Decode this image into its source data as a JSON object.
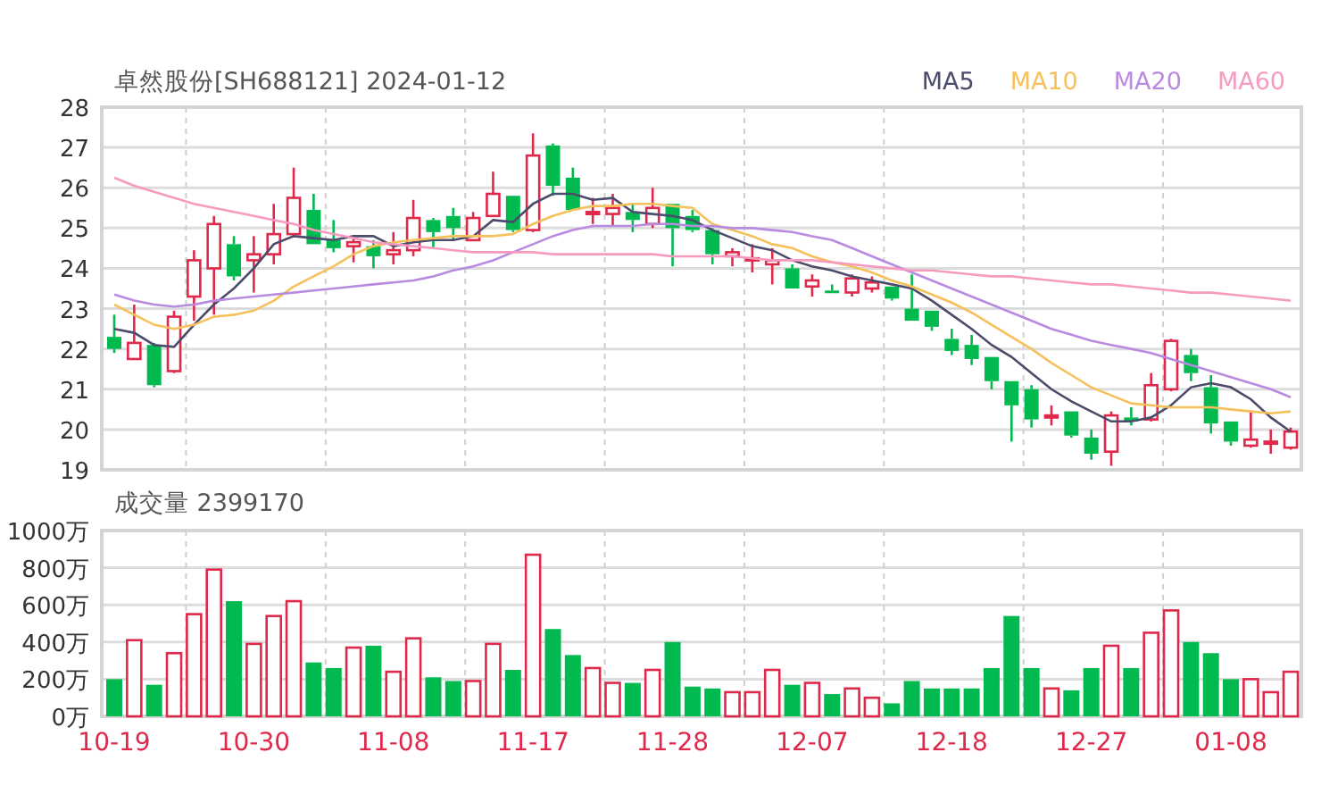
{
  "header": {
    "title": "卓然股份[SH688121] 2024-01-12"
  },
  "price_chart": {
    "chart_data": {
      "type": "candlestick",
      "grid": true,
      "ylim": [
        19,
        28
      ],
      "yticks": [
        19,
        20,
        21,
        22,
        23,
        24,
        25,
        26,
        27,
        28
      ],
      "ohlc": [
        [
          22.3,
          22.85,
          21.9,
          22.0
        ],
        [
          21.75,
          23.1,
          21.75,
          22.15
        ],
        [
          22.1,
          22.15,
          21.05,
          21.1
        ],
        [
          21.45,
          22.95,
          21.4,
          22.8
        ],
        [
          23.3,
          24.45,
          22.7,
          24.2
        ],
        [
          24.0,
          25.3,
          22.85,
          25.1
        ],
        [
          24.6,
          24.8,
          23.7,
          23.8
        ],
        [
          24.2,
          24.8,
          23.4,
          24.35
        ],
        [
          24.35,
          25.6,
          24.1,
          24.85
        ],
        [
          24.85,
          26.5,
          24.8,
          25.75
        ],
        [
          25.45,
          25.85,
          24.6,
          24.6
        ],
        [
          24.7,
          25.2,
          24.4,
          24.5
        ],
        [
          24.55,
          24.8,
          24.15,
          24.65
        ],
        [
          24.55,
          24.7,
          24.0,
          24.3
        ],
        [
          24.35,
          24.9,
          24.1,
          24.45
        ],
        [
          24.45,
          25.7,
          24.3,
          25.25
        ],
        [
          25.2,
          25.25,
          24.5,
          24.9
        ],
        [
          25.3,
          25.5,
          24.7,
          25.0
        ],
        [
          24.7,
          25.4,
          24.7,
          25.25
        ],
        [
          25.3,
          26.4,
          25.3,
          25.85
        ],
        [
          25.8,
          25.8,
          24.9,
          24.95
        ],
        [
          24.95,
          27.35,
          24.9,
          26.8
        ],
        [
          27.05,
          27.1,
          25.8,
          26.05
        ],
        [
          26.25,
          26.5,
          25.45,
          25.45
        ],
        [
          25.35,
          25.75,
          25.1,
          25.4
        ],
        [
          25.35,
          25.85,
          25.05,
          25.5
        ],
        [
          25.4,
          25.6,
          24.9,
          25.2
        ],
        [
          25.1,
          26.0,
          25.0,
          25.5
        ],
        [
          25.6,
          25.6,
          24.05,
          25.0
        ],
        [
          25.3,
          25.45,
          24.9,
          24.95
        ],
        [
          24.95,
          25.0,
          24.1,
          24.35
        ],
        [
          24.3,
          24.5,
          24.05,
          24.4
        ],
        [
          24.25,
          24.6,
          23.9,
          24.25
        ],
        [
          24.1,
          24.5,
          23.6,
          24.2
        ],
        [
          24.0,
          24.1,
          23.5,
          23.5
        ],
        [
          23.55,
          23.85,
          23.3,
          23.7
        ],
        [
          23.45,
          23.6,
          23.4,
          23.4
        ],
        [
          23.4,
          23.85,
          23.3,
          23.75
        ],
        [
          23.5,
          23.8,
          23.4,
          23.65
        ],
        [
          23.55,
          23.55,
          23.2,
          23.25
        ],
        [
          23.0,
          23.85,
          22.7,
          22.7
        ],
        [
          22.95,
          22.95,
          22.45,
          22.55
        ],
        [
          22.25,
          22.5,
          21.85,
          21.95
        ],
        [
          22.1,
          22.35,
          21.6,
          21.75
        ],
        [
          21.8,
          21.8,
          21.0,
          21.2
        ],
        [
          21.2,
          21.2,
          19.7,
          20.6
        ],
        [
          21.0,
          21.1,
          20.05,
          20.25
        ],
        [
          20.3,
          20.6,
          20.1,
          20.35
        ],
        [
          20.45,
          20.45,
          19.8,
          19.85
        ],
        [
          19.8,
          20.0,
          19.25,
          19.4
        ],
        [
          19.45,
          20.45,
          19.1,
          20.35
        ],
        [
          20.3,
          20.55,
          20.1,
          20.2
        ],
        [
          20.25,
          21.4,
          20.2,
          21.1
        ],
        [
          21.0,
          22.25,
          20.95,
          22.2
        ],
        [
          21.85,
          22.0,
          21.2,
          21.4
        ],
        [
          21.05,
          21.35,
          19.9,
          20.15
        ],
        [
          20.2,
          20.2,
          19.6,
          19.7
        ],
        [
          19.6,
          20.45,
          19.55,
          19.75
        ],
        [
          19.65,
          20.0,
          19.4,
          19.7
        ],
        [
          19.55,
          20.05,
          19.5,
          19.95
        ]
      ]
    }
  },
  "moving_averages": {
    "chart_data": {
      "type": "line",
      "ylim": [
        19,
        28
      ],
      "series": [
        {
          "name": "MA5",
          "color": "#4b4b6b",
          "values": [
            22.5,
            22.4,
            22.1,
            22.05,
            22.6,
            23.1,
            23.5,
            24.0,
            24.6,
            24.8,
            24.75,
            24.7,
            24.8,
            24.8,
            24.55,
            24.65,
            24.7,
            24.7,
            24.8,
            25.2,
            25.15,
            25.6,
            25.85,
            25.85,
            25.7,
            25.75,
            25.4,
            25.35,
            25.3,
            25.2,
            24.95,
            24.75,
            24.55,
            24.45,
            24.2,
            24.05,
            23.95,
            23.8,
            23.7,
            23.6,
            23.5,
            23.2,
            22.85,
            22.5,
            22.1,
            21.8,
            21.4,
            21.0,
            20.7,
            20.45,
            20.2,
            20.2,
            20.3,
            20.6,
            21.05,
            21.15,
            21.05,
            20.75,
            20.3,
            19.95
          ]
        },
        {
          "name": "MA10",
          "color": "#f6c05b",
          "values": [
            23.1,
            22.85,
            22.6,
            22.5,
            22.6,
            22.8,
            22.85,
            22.95,
            23.2,
            23.55,
            23.8,
            24.05,
            24.35,
            24.55,
            24.65,
            24.7,
            24.75,
            24.8,
            24.8,
            24.8,
            24.85,
            25.1,
            25.3,
            25.45,
            25.55,
            25.55,
            25.6,
            25.6,
            25.55,
            25.5,
            25.1,
            24.95,
            24.8,
            24.6,
            24.5,
            24.3,
            24.15,
            24.05,
            23.9,
            23.7,
            23.55,
            23.35,
            23.15,
            22.9,
            22.6,
            22.3,
            22.0,
            21.65,
            21.35,
            21.05,
            20.85,
            20.65,
            20.6,
            20.55,
            20.55,
            20.55,
            20.5,
            20.45,
            20.4,
            20.45
          ]
        },
        {
          "name": "MA20",
          "color": "#b88ae0",
          "values": [
            23.35,
            23.2,
            23.1,
            23.05,
            23.1,
            23.2,
            23.25,
            23.3,
            23.35,
            23.4,
            23.45,
            23.5,
            23.55,
            23.6,
            23.65,
            23.7,
            23.8,
            23.95,
            24.05,
            24.2,
            24.4,
            24.6,
            24.8,
            24.95,
            25.05,
            25.05,
            25.05,
            25.1,
            25.1,
            25.05,
            25.05,
            25.0,
            25.0,
            24.95,
            24.9,
            24.8,
            24.7,
            24.5,
            24.3,
            24.1,
            23.9,
            23.7,
            23.5,
            23.3,
            23.1,
            22.9,
            22.7,
            22.5,
            22.35,
            22.2,
            22.1,
            22.0,
            21.9,
            21.75,
            21.6,
            21.45,
            21.3,
            21.15,
            21.0,
            20.8
          ]
        },
        {
          "name": "MA60",
          "color": "#f79ac0",
          "values": [
            26.25,
            26.05,
            25.9,
            25.75,
            25.6,
            25.5,
            25.4,
            25.3,
            25.2,
            25.1,
            24.95,
            24.85,
            24.75,
            24.65,
            24.6,
            24.55,
            24.5,
            24.45,
            24.4,
            24.4,
            24.4,
            24.4,
            24.35,
            24.35,
            24.35,
            24.35,
            24.35,
            24.35,
            24.3,
            24.3,
            24.3,
            24.3,
            24.25,
            24.2,
            24.2,
            24.2,
            24.15,
            24.1,
            24.05,
            24.0,
            23.95,
            23.95,
            23.9,
            23.85,
            23.8,
            23.8,
            23.75,
            23.7,
            23.65,
            23.6,
            23.6,
            23.55,
            23.5,
            23.45,
            23.4,
            23.4,
            23.35,
            23.3,
            23.25,
            23.2
          ]
        }
      ]
    }
  },
  "volume_chart": {
    "title": "成交量 2399170",
    "chart_data": {
      "type": "bar",
      "grid": true,
      "ylim": [
        0,
        1000
      ],
      "yticks": [
        {
          "value": 0,
          "label": "0万"
        },
        {
          "value": 200,
          "label": "200万"
        },
        {
          "value": 400,
          "label": "400万"
        },
        {
          "value": 600,
          "label": "600万"
        },
        {
          "value": 800,
          "label": "800万"
        },
        {
          "value": 1000,
          "label": "1000万"
        }
      ],
      "categories": [
        "10-19",
        null,
        null,
        null,
        null,
        null,
        null,
        "10-30",
        null,
        null,
        null,
        null,
        null,
        null,
        "11-08",
        null,
        null,
        null,
        null,
        null,
        null,
        "11-17",
        null,
        null,
        null,
        null,
        null,
        null,
        "11-28",
        null,
        null,
        null,
        null,
        null,
        null,
        "12-07",
        null,
        null,
        null,
        null,
        null,
        null,
        "12-18",
        null,
        null,
        null,
        null,
        null,
        null,
        "12-27",
        null,
        null,
        null,
        null,
        null,
        null,
        "01-08",
        null,
        null,
        null
      ],
      "values": [
        200,
        410,
        170,
        340,
        550,
        790,
        620,
        390,
        540,
        620,
        290,
        260,
        370,
        380,
        240,
        420,
        210,
        190,
        190,
        390,
        250,
        870,
        470,
        330,
        260,
        180,
        180,
        250,
        400,
        160,
        150,
        130,
        130,
        250,
        170,
        180,
        120,
        150,
        100,
        70,
        190,
        150,
        150,
        150,
        260,
        540,
        260,
        150,
        140,
        260,
        380,
        260,
        450,
        570,
        400,
        340,
        200,
        200,
        130,
        240
      ]
    }
  }
}
